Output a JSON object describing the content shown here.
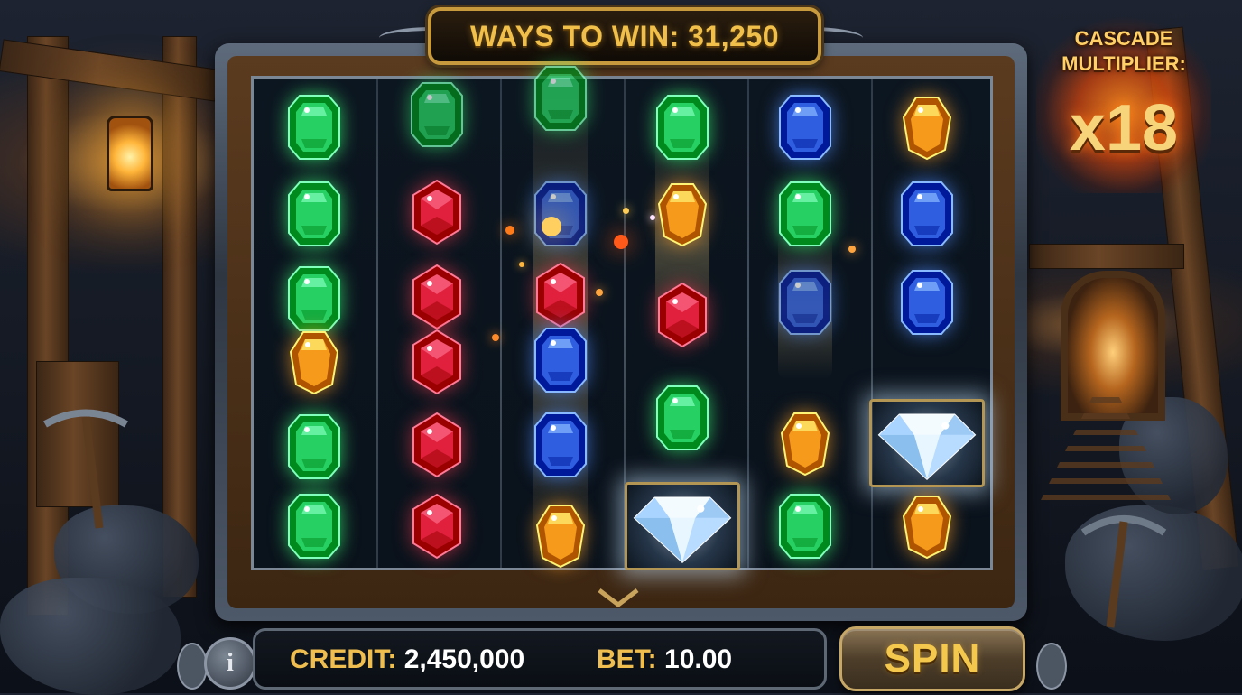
{
  "header": {
    "ways_label": "WAYS TO WIN: 31,250"
  },
  "multiplier": {
    "label_line1": "CASCADE",
    "label_line2": "MULTIPLIER:",
    "value": "x18"
  },
  "bottom_bar": {
    "info_label": "i",
    "credit_key": "CREDIT:",
    "credit_value": "2,450,000",
    "bet_key": "BET:",
    "bet_value": "10.00",
    "spin_label": "SPIN"
  },
  "reels": [
    [
      "green",
      "green",
      "green",
      "orange",
      "green",
      "green"
    ],
    [
      "green",
      "red",
      "red",
      "red",
      "red",
      "red"
    ],
    [
      "green",
      "blue",
      "red",
      "blue",
      "blue",
      "orange"
    ],
    [
      "green",
      "orange",
      "red",
      "green",
      "diamond"
    ],
    [
      "blue",
      "green",
      "blue",
      "orange",
      "green"
    ],
    [
      "orange",
      "blue",
      "blue",
      "diamond",
      "orange"
    ]
  ],
  "colors": {
    "green": "#27d063",
    "red": "#e0203c",
    "blue": "#2f5fe0",
    "orange": "#f59a1b",
    "accent_gold": "#f0be4e",
    "frame_steel": "#7c8796"
  }
}
